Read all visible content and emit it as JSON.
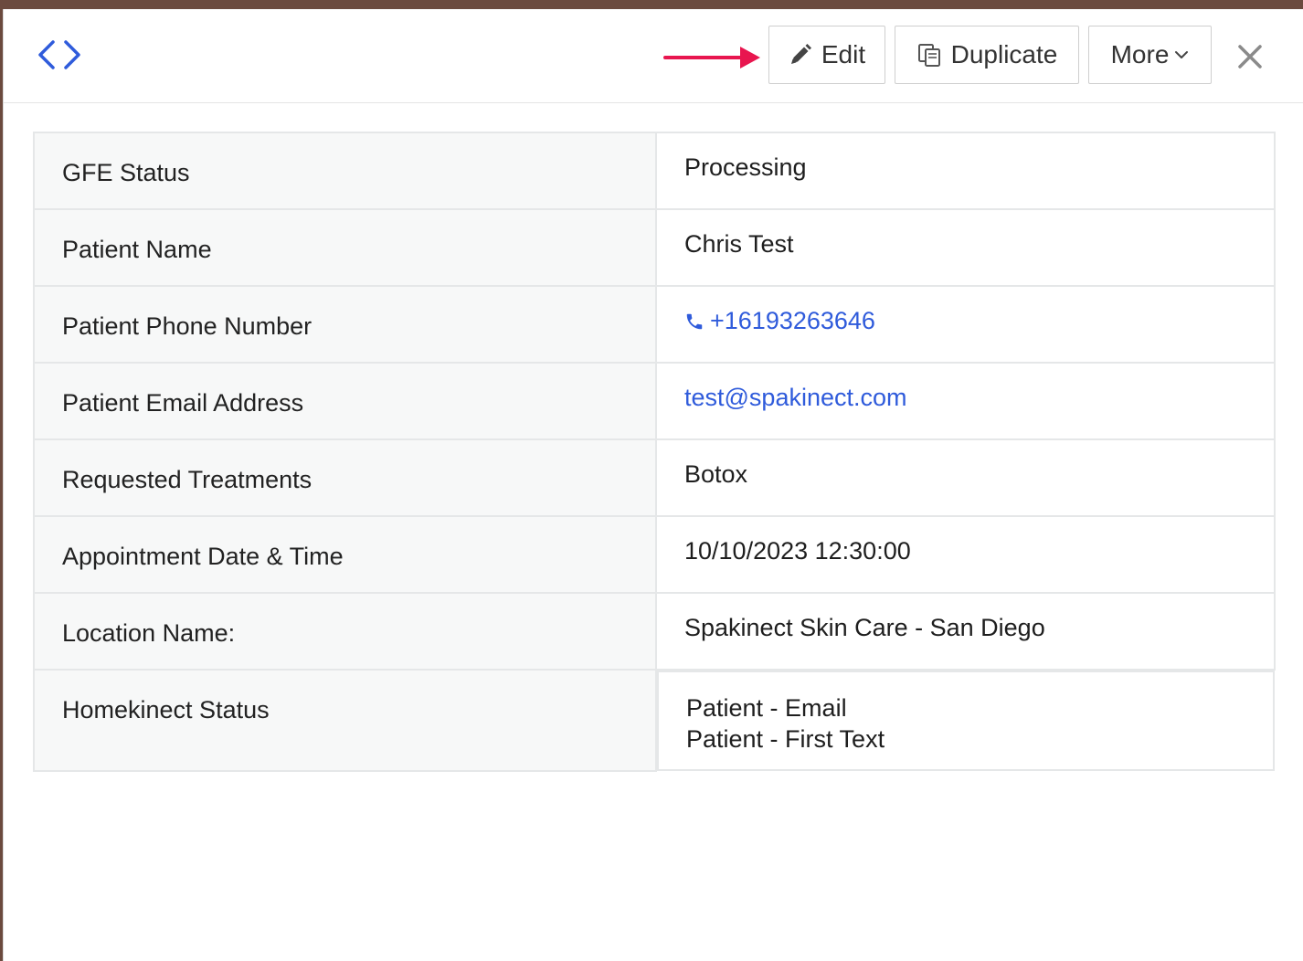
{
  "toolbar": {
    "edit_label": "Edit",
    "duplicate_label": "Duplicate",
    "more_label": "More"
  },
  "colors": {
    "accent": "#2f5bdb",
    "annotation_arrow": "#e8164f",
    "label_bg": "#f7f8f8",
    "border": "#e5e7e8"
  },
  "fields": [
    {
      "label": "GFE Status",
      "value": "Processing"
    },
    {
      "label": "Patient Name",
      "value": "Chris Test"
    },
    {
      "label": "Patient Phone Number",
      "value": "+16193263646"
    },
    {
      "label": "Patient Email Address",
      "value": "test@spakinect.com"
    },
    {
      "label": "Requested Treatments",
      "value": "Botox"
    },
    {
      "label": "Appointment Date & Time",
      "value": "10/10/2023 12:30:00"
    },
    {
      "label": "Location Name:",
      "value": "Spakinect Skin Care - San Diego"
    },
    {
      "label": "Homekinect Status",
      "values": [
        "Patient - Email",
        "Patient - First Text"
      ]
    }
  ],
  "icons": {
    "nav": "code-brackets-icon",
    "edit": "pencil-icon",
    "duplicate": "copy-icon",
    "more": "chevron-down-icon",
    "close": "close-icon",
    "phone": "phone-icon"
  }
}
